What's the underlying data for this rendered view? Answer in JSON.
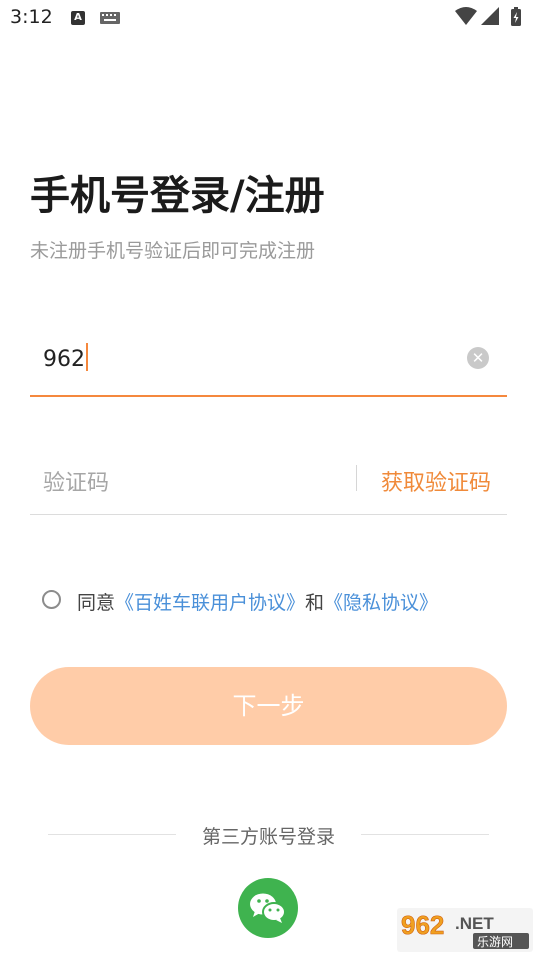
{
  "status_bar": {
    "time": "3:12",
    "notif_a": "A"
  },
  "login": {
    "title": "手机号登录/注册",
    "subtitle": "未注册手机号验证后即可完成注册",
    "phone_value": "962",
    "code_placeholder": "验证码",
    "get_code_label": "获取验证码"
  },
  "agreement": {
    "prefix": "同意",
    "user_agreement": "《百姓车联用户协议》",
    "and": "和",
    "privacy": "《隐私协议》"
  },
  "next_button": "下一步",
  "third_party": {
    "label": "第三方账号登录"
  },
  "watermark": {
    "brand": "962.NET",
    "sub": "乐游网"
  },
  "colors": {
    "accent": "#f5883d",
    "button": "#ffcca8",
    "link": "#4a90d9",
    "wechat": "#3fb34f"
  },
  "icons": [
    "wifi-icon",
    "signal-icon",
    "battery-icon",
    "clear-icon",
    "wechat-icon"
  ]
}
